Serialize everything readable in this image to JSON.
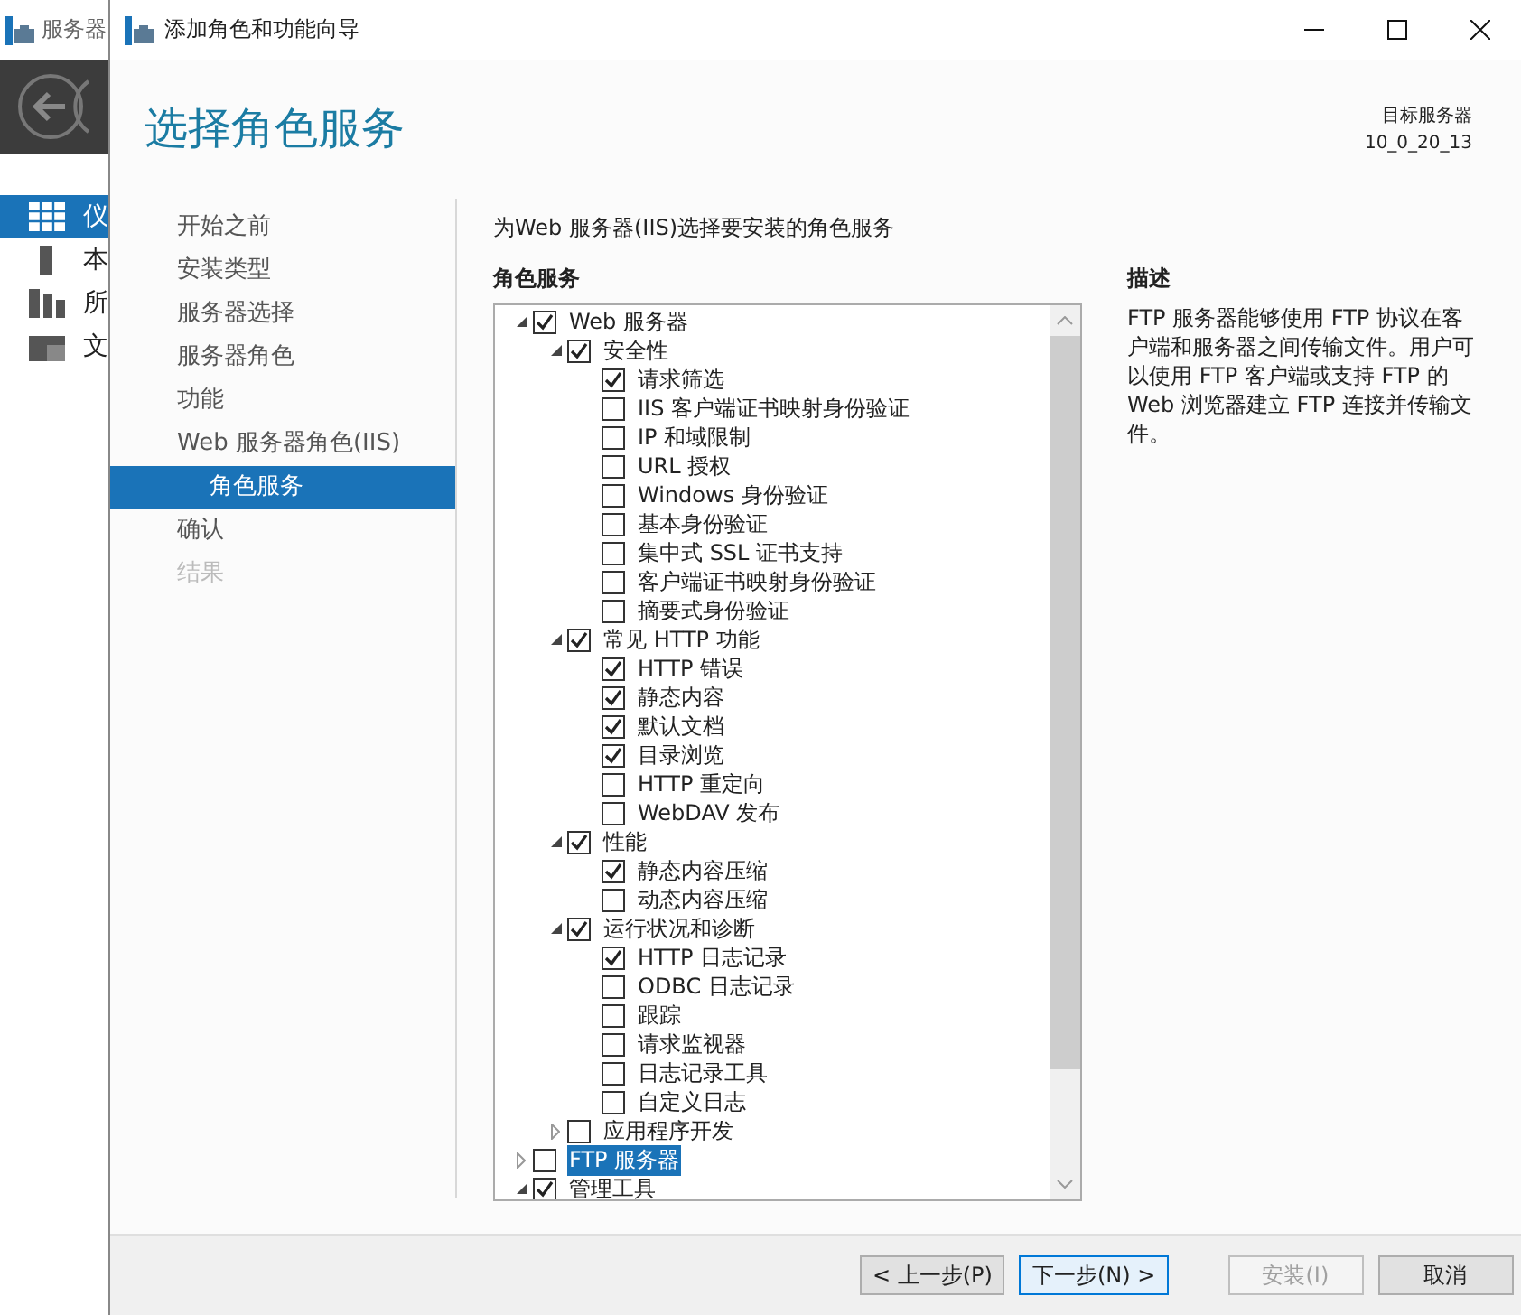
{
  "background_window": {
    "title": "服务器",
    "nav_items": [
      {
        "label": "仪",
        "selected": true
      },
      {
        "label": "本",
        "selected": false
      },
      {
        "label": "所",
        "selected": false
      },
      {
        "label": "文",
        "selected": false
      }
    ]
  },
  "dialog": {
    "title": "添加角色和功能向导",
    "heading": "选择角色服务",
    "target_server": {
      "label": "目标服务器",
      "name": "10_0_20_13"
    },
    "steps": [
      {
        "label": "开始之前",
        "selected": false,
        "disabled": false
      },
      {
        "label": "安装类型",
        "selected": false,
        "disabled": false
      },
      {
        "label": "服务器选择",
        "selected": false,
        "disabled": false
      },
      {
        "label": "服务器角色",
        "selected": false,
        "disabled": false
      },
      {
        "label": "功能",
        "selected": false,
        "disabled": false
      },
      {
        "label": "Web 服务器角色(IIS)",
        "selected": false,
        "disabled": false,
        "children": [
          {
            "label": "角色服务",
            "selected": true,
            "disabled": false
          }
        ]
      },
      {
        "label": "确认",
        "selected": false,
        "disabled": false
      },
      {
        "label": "结果",
        "selected": false,
        "disabled": true
      }
    ],
    "instruction": "为Web 服务器(IIS)选择要安装的角色服务",
    "tree_heading": "角色服务",
    "tree": [
      {
        "label": "Web 服务器",
        "checked": true,
        "expanded": true,
        "selected": false,
        "children": [
          {
            "label": "安全性",
            "checked": true,
            "expanded": true,
            "selected": false,
            "children": [
              {
                "label": "请求筛选",
                "checked": true,
                "selected": false
              },
              {
                "label": "IIS 客户端证书映射身份验证",
                "checked": false,
                "selected": false
              },
              {
                "label": "IP 和域限制",
                "checked": false,
                "selected": false
              },
              {
                "label": "URL 授权",
                "checked": false,
                "selected": false
              },
              {
                "label": "Windows 身份验证",
                "checked": false,
                "selected": false
              },
              {
                "label": "基本身份验证",
                "checked": false,
                "selected": false
              },
              {
                "label": "集中式 SSL 证书支持",
                "checked": false,
                "selected": false
              },
              {
                "label": "客户端证书映射身份验证",
                "checked": false,
                "selected": false
              },
              {
                "label": "摘要式身份验证",
                "checked": false,
                "selected": false
              }
            ]
          },
          {
            "label": "常见 HTTP 功能",
            "checked": true,
            "expanded": true,
            "selected": false,
            "children": [
              {
                "label": "HTTP 错误",
                "checked": true,
                "selected": false
              },
              {
                "label": "静态内容",
                "checked": true,
                "selected": false
              },
              {
                "label": "默认文档",
                "checked": true,
                "selected": false
              },
              {
                "label": "目录浏览",
                "checked": true,
                "selected": false
              },
              {
                "label": "HTTP 重定向",
                "checked": false,
                "selected": false
              },
              {
                "label": "WebDAV 发布",
                "checked": false,
                "selected": false
              }
            ]
          },
          {
            "label": "性能",
            "checked": true,
            "expanded": true,
            "selected": false,
            "children": [
              {
                "label": "静态内容压缩",
                "checked": true,
                "selected": false
              },
              {
                "label": "动态内容压缩",
                "checked": false,
                "selected": false
              }
            ]
          },
          {
            "label": "运行状况和诊断",
            "checked": true,
            "expanded": true,
            "selected": false,
            "children": [
              {
                "label": "HTTP 日志记录",
                "checked": true,
                "selected": false
              },
              {
                "label": "ODBC 日志记录",
                "checked": false,
                "selected": false
              },
              {
                "label": "跟踪",
                "checked": false,
                "selected": false
              },
              {
                "label": "请求监视器",
                "checked": false,
                "selected": false
              },
              {
                "label": "日志记录工具",
                "checked": false,
                "selected": false
              },
              {
                "label": "自定义日志",
                "checked": false,
                "selected": false
              }
            ]
          },
          {
            "label": "应用程序开发",
            "checked": false,
            "expanded": false,
            "selected": false
          }
        ]
      },
      {
        "label": "FTP 服务器",
        "checked": false,
        "expanded": false,
        "selected": true
      },
      {
        "label": "管理工具",
        "checked": true,
        "expanded": true,
        "selected": false
      }
    ],
    "description": {
      "heading": "描述",
      "text": "FTP 服务器能够使用 FTP 协议在客户端和服务器之间传输文件。用户可以使用 FTP 客户端或支持 FTP 的 Web 浏览器建立 FTP 连接并传输文件。"
    },
    "buttons": [
      {
        "label": "< 上一步(P)",
        "disabled": false,
        "focused": false
      },
      {
        "label": "下一步(N) >",
        "disabled": false,
        "focused": true
      },
      {
        "label": "安装(I)",
        "disabled": true,
        "focused": false
      },
      {
        "label": "取消",
        "disabled": false,
        "focused": false
      }
    ]
  }
}
